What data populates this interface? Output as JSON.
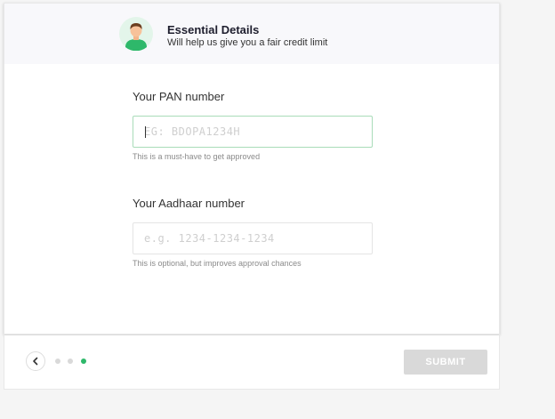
{
  "header": {
    "title": "Essential Details",
    "subtitle": "Will help us give you a fair credit limit",
    "avatar_icon": "user-avatar-icon"
  },
  "pan": {
    "label": "Your PAN number",
    "placeholder": "EG: BDOPA1234H",
    "value": "",
    "helper": "This is a must-have to get approved"
  },
  "aadhaar": {
    "label": "Your Aadhaar number",
    "placeholder": "e.g. 1234-1234-1234",
    "value": "",
    "helper": "This is optional, but improves approval chances"
  },
  "footer": {
    "back_icon": "chevron-left-icon",
    "steps_total": 3,
    "current_step": 3,
    "submit_label": "SUBMIT"
  },
  "colors": {
    "accent": "#2eb86a",
    "active_input_border": "#a9dcb9",
    "disabled_button": "#d9d9d9",
    "header_bg": "#f8f8fb"
  }
}
